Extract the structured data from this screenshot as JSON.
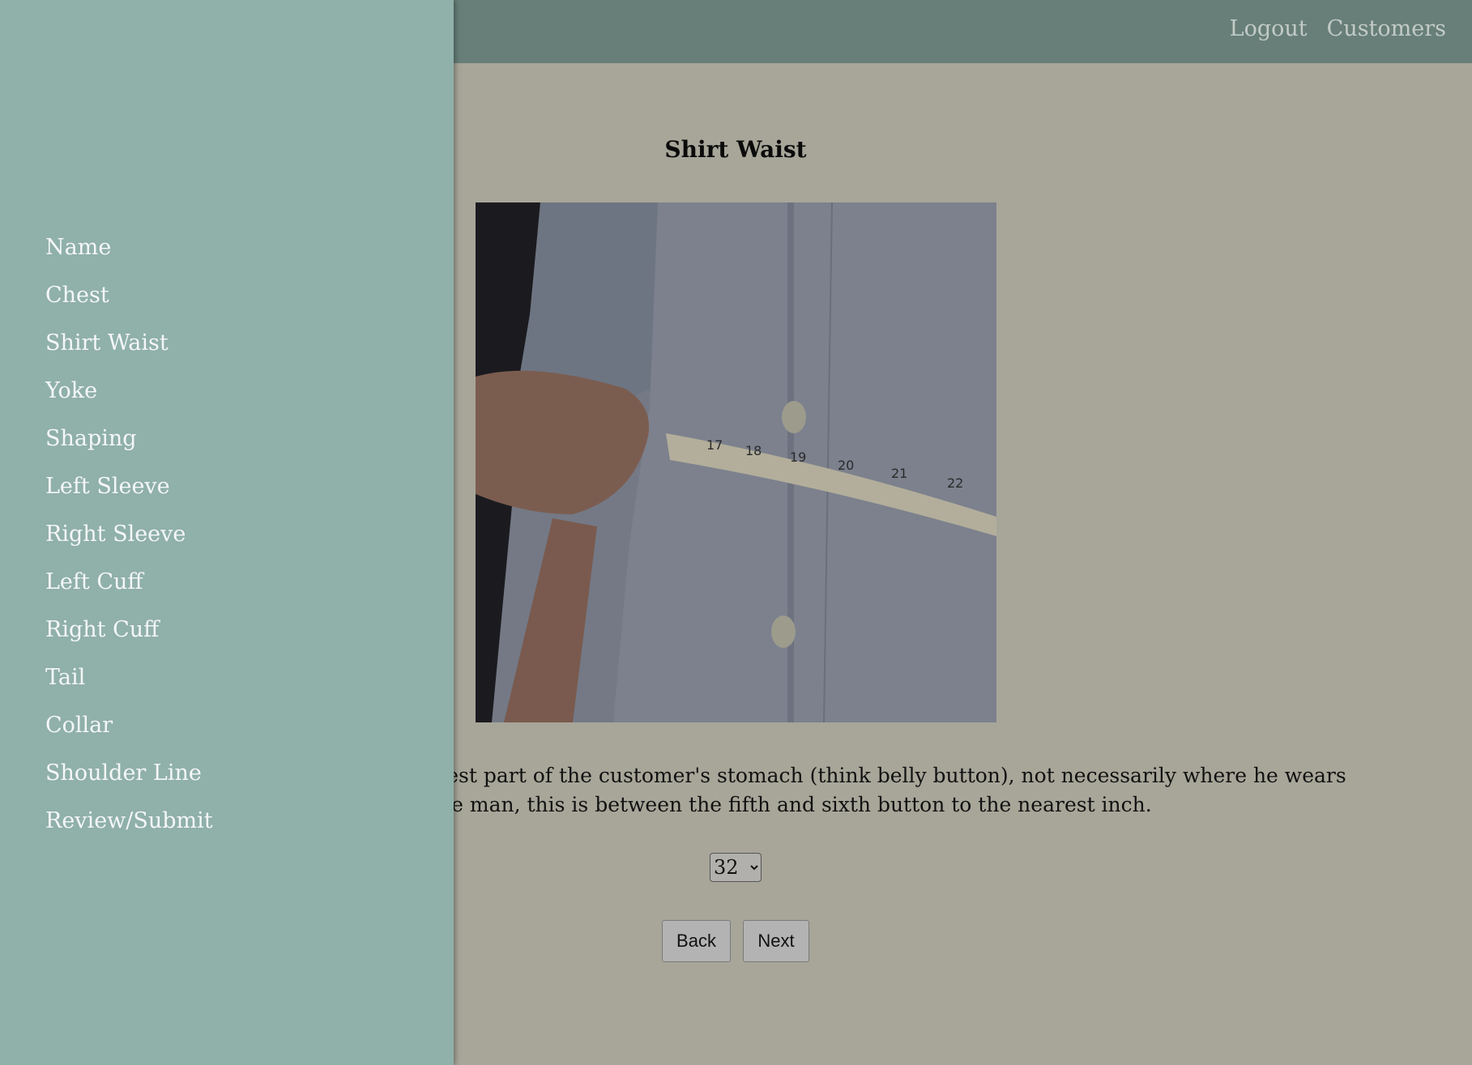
{
  "topnav": {
    "logout": "Logout",
    "customers": "Customers"
  },
  "main": {
    "title": "Shirt Waist",
    "instructions": "Measure around the widest part of the customer's stomach (think belly button), not necessarily where he wears his pants. For the average man, this is between the fifth and sixth button to the nearest inch.",
    "measurement_value": "32",
    "back_label": "Back",
    "next_label": "Next"
  },
  "sidebar": {
    "items": [
      {
        "label": "Name"
      },
      {
        "label": "Chest"
      },
      {
        "label": "Shirt Waist"
      },
      {
        "label": "Yoke"
      },
      {
        "label": "Shaping"
      },
      {
        "label": "Left Sleeve"
      },
      {
        "label": "Right Sleeve"
      },
      {
        "label": "Left Cuff"
      },
      {
        "label": "Right Cuff"
      },
      {
        "label": "Tail"
      },
      {
        "label": "Collar"
      },
      {
        "label": "Shoulder Line"
      },
      {
        "label": "Review/Submit"
      }
    ]
  },
  "photo": {
    "tape_numbers": [
      "17",
      "18",
      "19",
      "20",
      "21",
      "22"
    ]
  },
  "colors": {
    "topbar": "#677f78",
    "page_background": "#a7a699",
    "sidebar": "#90b0aa",
    "sidebar_text": "#f4f7f6"
  }
}
